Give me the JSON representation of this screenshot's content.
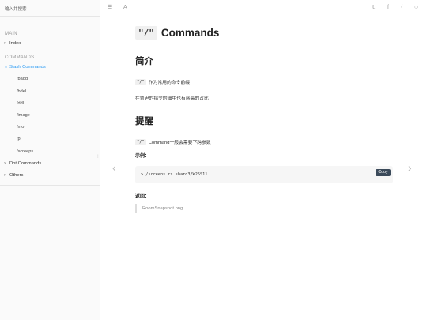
{
  "sidebar": {
    "search_placeholder": "输入并搜索",
    "sections": [
      {
        "title": "MAIN"
      },
      {
        "title": "COMMANDS"
      }
    ],
    "main_items": [
      {
        "label": "Index",
        "chev": "›"
      }
    ],
    "commands_items": [
      {
        "label": "Slash Commands",
        "chev": "⌄",
        "active": true
      },
      {
        "label": "Dot Commands",
        "chev": "›"
      },
      {
        "label": "Others",
        "chev": "›"
      }
    ],
    "slash_children": [
      "/badd",
      "/bdel",
      "/ddl",
      "/image",
      "/mo",
      "/p",
      "/screeps"
    ]
  },
  "topbar": {
    "icons": [
      "menu-icon",
      "font-icon",
      "twitter-icon",
      "facebook-icon",
      "share-icon",
      "info-icon"
    ],
    "glyphs": {
      "menu": "☰",
      "font": "A",
      "twitter": "𝕥",
      "facebook": "f",
      "share": "⟨",
      "info": "○"
    }
  },
  "page": {
    "title_code": "\"/\"",
    "title_text": "Commands",
    "h_intro": "简介",
    "intro_code": "\"/\"",
    "intro_text": "作为常用的命令前缀",
    "intro_p2": "在冒尹的指令的细中也有惑高的占比",
    "h_remind": "提醒",
    "remind_code": "\"/\"",
    "remind_text": "Command一般会需要下跨参数",
    "example_label": "示例：",
    "code_line": "> /screeps rs shard3/W25S11",
    "copy_label": "Copy",
    "return_label": "返回：",
    "return_quote": "RoomSnapshot.png"
  },
  "nav_arrows": {
    "prev": "‹",
    "next": "›"
  },
  "colors": {
    "accent": "#2196f3",
    "copy_bg": "#3b4a5a"
  }
}
